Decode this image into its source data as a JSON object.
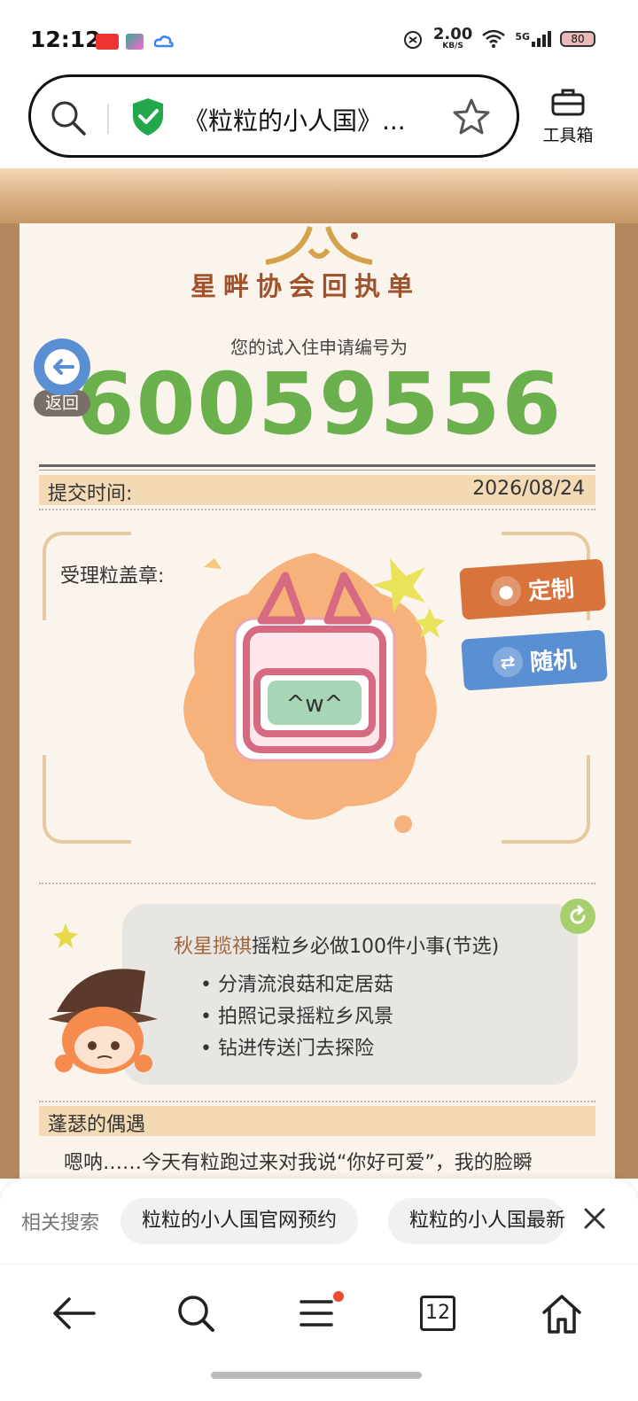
{
  "status_bar": {
    "time": "12:12",
    "app_icons": [
      "toutiao-icon",
      "video-app-icon",
      "cloud-app-icon"
    ],
    "net_speed_value": "2.00",
    "net_speed_unit": "KB/S",
    "signal": "5G",
    "battery": "80"
  },
  "url_bar": {
    "title": "《粒粒的小人国》...",
    "toolbox_label": "工具箱"
  },
  "page": {
    "sheet_title": "星畔协会回执单",
    "application_label": "您的试入住申请编号为",
    "application_number": "60059556",
    "back_label": "返回",
    "submit_time_label": "提交时间:",
    "submit_time_value": "2026/08/24",
    "stamp_label": "受理粒盖章:",
    "stamp_face": "^w^",
    "custom_button": "定制",
    "random_button": "随机",
    "tip": {
      "name": "秋星揽祺",
      "title_rest": "摇粒乡必做100件小事(节选)",
      "items": [
        "分清流浪菇和定居菇",
        "拍照记录摇粒乡风景",
        "钻进传送门去探险"
      ]
    },
    "encounter_title": "蓬瑟的偶遇",
    "encounter_text": "嗯呐……今天有粒跑过来对我说“你好可爱”，我的脸瞬"
  },
  "related_search": {
    "label": "相关搜索",
    "chips": [
      "粒粒的小人国官网预约",
      "粒粒的小人国最新"
    ]
  },
  "bottom_nav": {
    "tab_count": "12"
  },
  "colors": {
    "number_green": "#6ab04c",
    "custom_orange": "#d9733c",
    "random_blue": "#5b8fd4",
    "band_tan": "#f3d9b4"
  }
}
